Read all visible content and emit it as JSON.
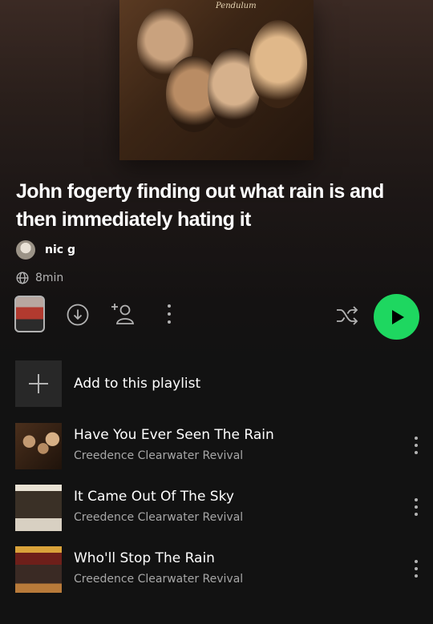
{
  "playlist": {
    "title": "John fogerty finding out what rain is and then immediately hating it",
    "owner": "nic g",
    "duration": "8min",
    "cover_text": "Pendulum"
  },
  "add_row": {
    "label": "Add to this playlist"
  },
  "tracks": [
    {
      "title": "Have You Ever Seen The Rain",
      "artist": "Creedence Clearwater Revival"
    },
    {
      "title": "It Came Out Of The Sky",
      "artist": "Creedence Clearwater Revival"
    },
    {
      "title": "Who'll Stop The Rain",
      "artist": "Creedence Clearwater Revival"
    }
  ],
  "icons": {
    "duration": "globe-icon",
    "download": "download-icon",
    "add_user": "add-user-icon",
    "more": "more-vertical-icon",
    "shuffle": "shuffle-icon",
    "play": "play-icon",
    "add": "plus-icon"
  },
  "colors": {
    "accent": "#1ed760",
    "background": "#121212",
    "secondary_text": "#a7a7a7"
  }
}
